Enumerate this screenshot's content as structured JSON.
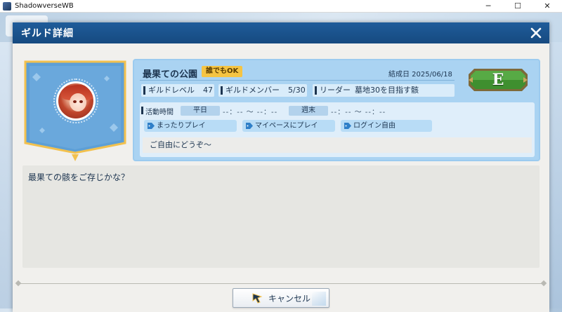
{
  "window": {
    "title": "ShadowverseWB",
    "minimize_glyph": "─",
    "maximize_glyph": "☐",
    "close_glyph": "✕"
  },
  "dialog": {
    "title": "ギルド詳細",
    "close_icon": "close-icon"
  },
  "guild": {
    "name": "最果ての公園",
    "join_policy": "誰でもOK",
    "founded": "結成日 2025/06/18",
    "rank": "E",
    "level_label": "ギルドレベル",
    "level_value": "47",
    "members_label": "ギルドメンバー",
    "members_value": "5/30",
    "leader_label": "リーダー",
    "leader_value": "墓地30を目指す骸",
    "activity": {
      "label": "活動時間",
      "weekday_label": "平日",
      "weekday_time": "--：-- 〜 --：--",
      "weekend_label": "週末",
      "weekend_time": "--：-- 〜 --：--"
    },
    "tags": [
      "まったりプレイ",
      "マイペースにプレイ",
      "ログイン自由"
    ],
    "comment": "ご自由にどうぞ〜",
    "description": "最果ての骸をご存じかな？"
  },
  "footer": {
    "cancel_label": "キャンセル"
  },
  "colors": {
    "header": "#164a80",
    "panel": "#aad3f2",
    "badge": "#f5c443",
    "rank_plate": "#3c8a2e"
  }
}
